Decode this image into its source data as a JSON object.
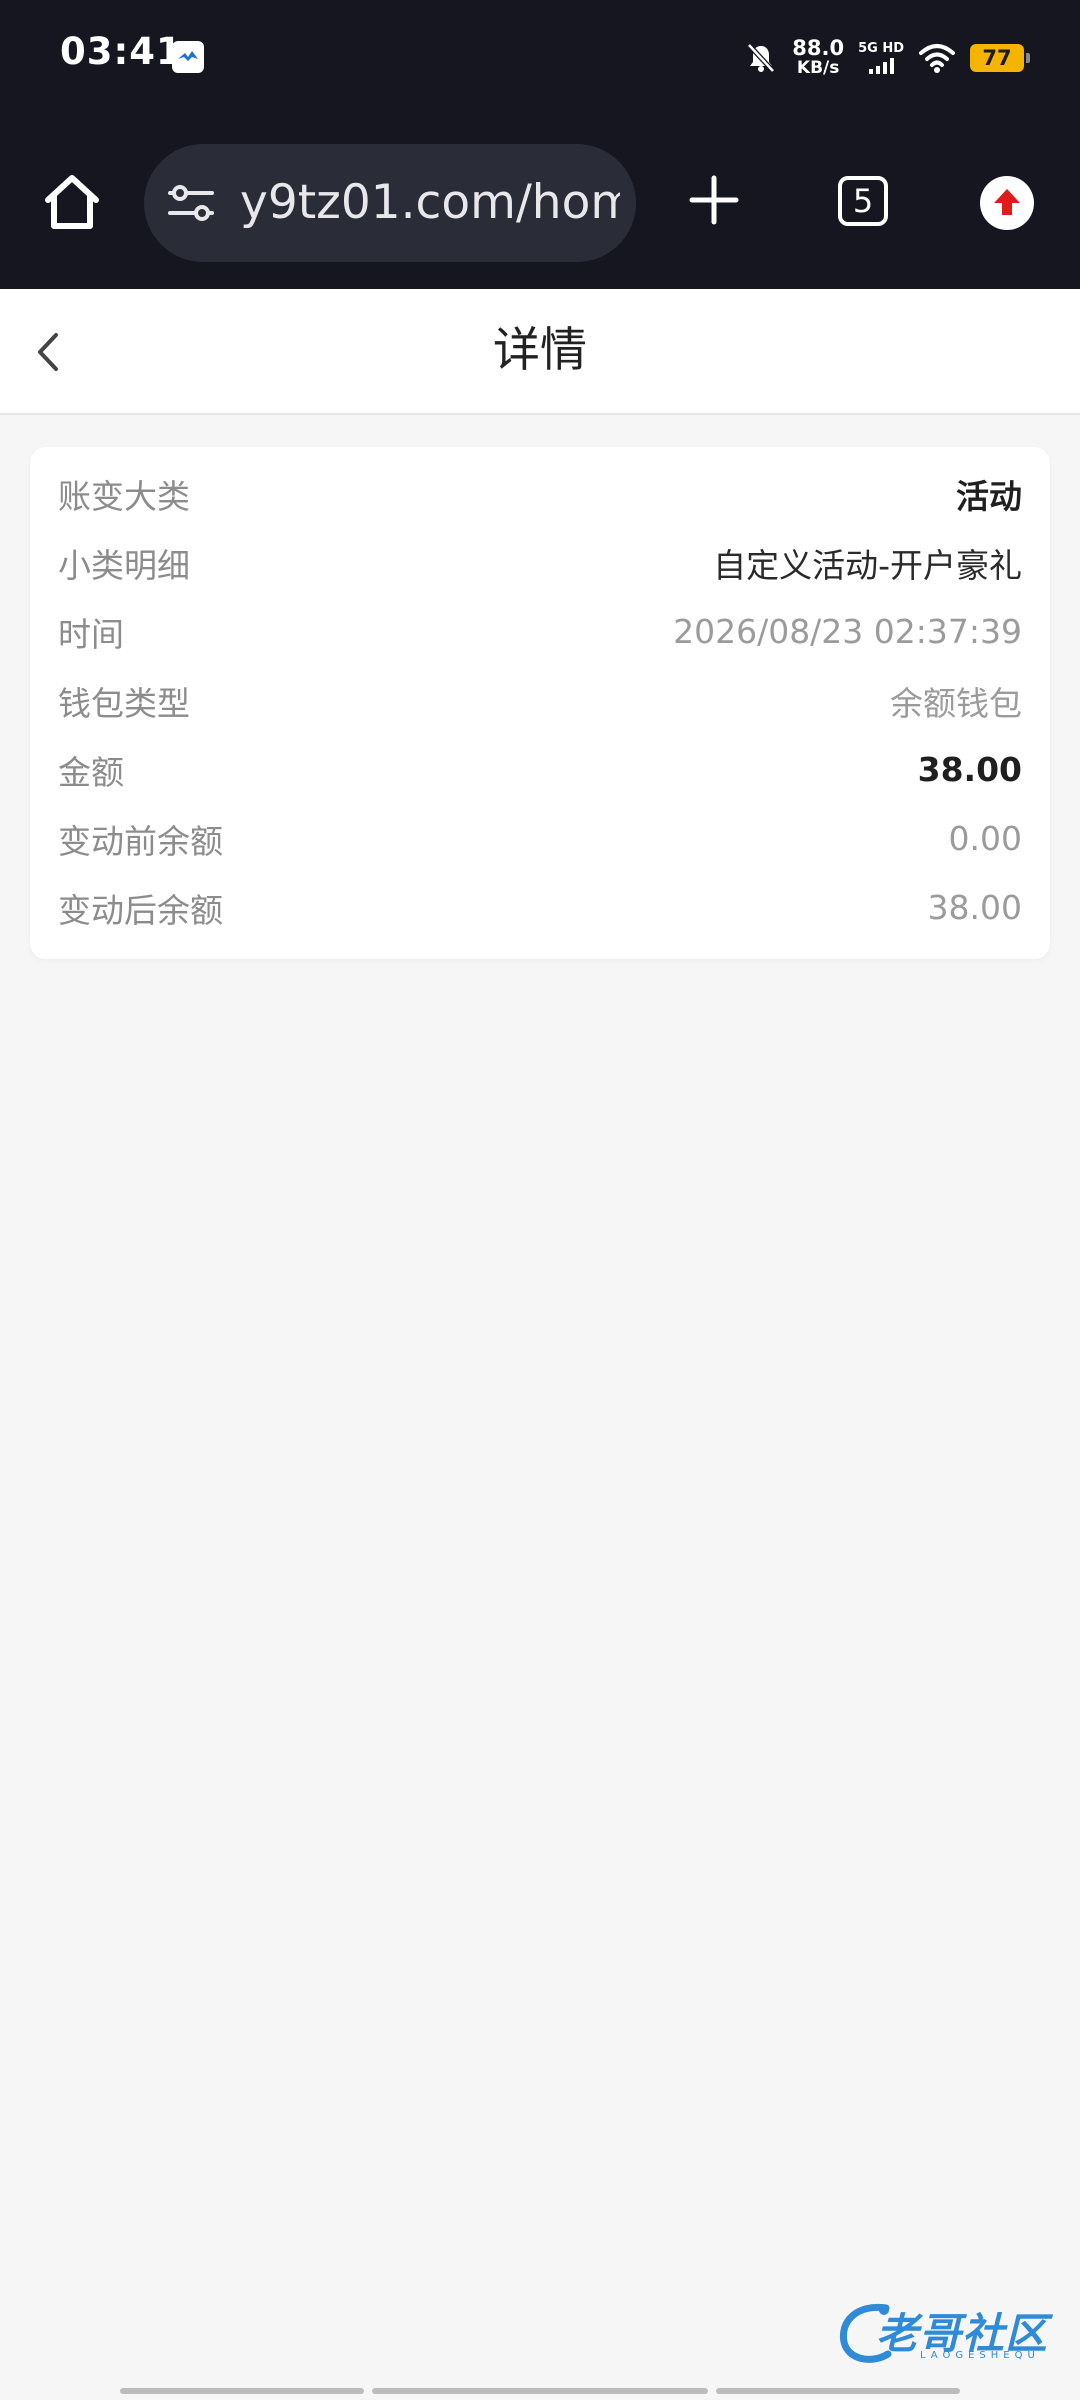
{
  "status_bar": {
    "time": "03:41",
    "net_speed_value": "88.0",
    "net_speed_unit": "KB/s",
    "network_label": "5G HD",
    "battery": "77"
  },
  "browser": {
    "url": "y9tz01.com/home",
    "tab_count": "5"
  },
  "page": {
    "title": "详情"
  },
  "details": [
    {
      "label": "账变大类",
      "value": "活动"
    },
    {
      "label": "小类明细",
      "value": "自定义活动-开户豪礼"
    },
    {
      "label": "时间",
      "value": "2026/08/23 02:37:39"
    },
    {
      "label": "钱包类型",
      "value": "余额钱包"
    },
    {
      "label": "金额",
      "value": "38.00"
    },
    {
      "label": "变动前余额",
      "value": "0.00"
    },
    {
      "label": "变动后余额",
      "value": "38.00"
    }
  ],
  "watermark": {
    "text": "老哥社区",
    "sub": "LAOGESHEQU"
  }
}
